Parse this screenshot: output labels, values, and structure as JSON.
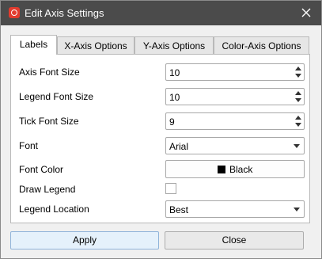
{
  "window": {
    "title": "Edit Axis Settings"
  },
  "tabs": [
    {
      "label": "Labels"
    },
    {
      "label": "X-Axis Options"
    },
    {
      "label": "Y-Axis Options"
    },
    {
      "label": "Color-Axis Options"
    }
  ],
  "form": {
    "axis_font_size": {
      "label": "Axis Font Size",
      "value": "10"
    },
    "legend_font_size": {
      "label": "Legend Font Size",
      "value": "10"
    },
    "tick_font_size": {
      "label": "Tick Font Size",
      "value": "9"
    },
    "font": {
      "label": "Font",
      "value": "Arial"
    },
    "font_color": {
      "label": "Font Color",
      "value": "Black",
      "swatch": "#000000"
    },
    "draw_legend": {
      "label": "Draw Legend",
      "checked": false
    },
    "legend_location": {
      "label": "Legend Location",
      "value": "Best"
    }
  },
  "buttons": {
    "apply": "Apply",
    "close": "Close"
  },
  "colors": {
    "titlebar": "#4b4b4b",
    "app_icon": "#e23b2e"
  },
  "icons": {
    "app": "app-logo-icon",
    "close": "close-icon"
  }
}
